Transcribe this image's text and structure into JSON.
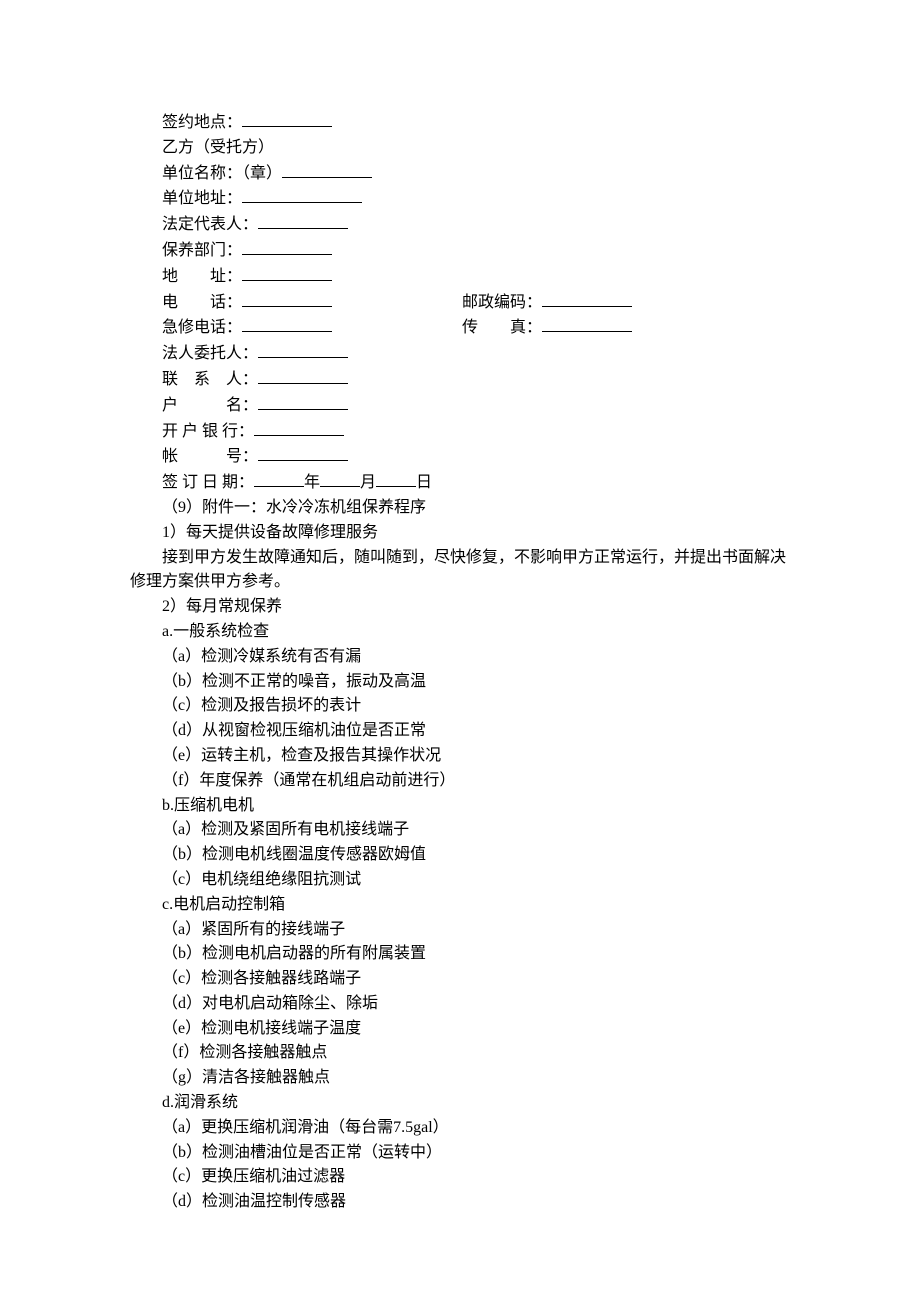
{
  "form": {
    "sign_location_label": "签约地点：",
    "party_b_label": "乙方（受托方）",
    "unit_name_label": "单位名称：（章）",
    "unit_address_label": "单位地址：",
    "legal_rep_label": "法定代表人：",
    "maintenance_dept_label": "保养部门：",
    "address_label": "地  址：",
    "phone_label": "电  话：",
    "postal_code_label": "邮政编码：",
    "urgent_phone_label": "急修电话：",
    "fax_label": "传  真：",
    "legal_entrustee_label": "法人委托人：",
    "contact_label": "联 系 人：",
    "account_name_label": "户   名：",
    "bank_label": "开 户 银 行：",
    "account_number_label": "帐   号：",
    "sign_date_label": "签 订 日 期：",
    "year": "年",
    "month": "月",
    "day": "日"
  },
  "appendix": {
    "title": "（9）附件一：水冷冷冻机组保养程序",
    "item1": "1）每天提供设备故障修理服务",
    "item1_desc": "接到甲方发生故障通知后，随叫随到，尽快修复，不影响甲方正常运行，并提出书面解决修理方案供甲方参考。",
    "item2": "2）每月常规保养",
    "a_title": "a.一般系统检查",
    "a_items": [
      "（a）检测冷媒系统有否有漏",
      "（b）检测不正常的噪音，振动及高温",
      "（c）检测及报告损坏的表计",
      "（d）从视窗检视压缩机油位是否正常",
      "（e）运转主机，检查及报告其操作状况",
      "（f）年度保养（通常在机组启动前进行）"
    ],
    "b_title": "b.压缩机电机",
    "b_items": [
      "（a）检测及紧固所有电机接线端子",
      "（b）检测电机线圈温度传感器欧姆值",
      "（c）电机绕组绝缘阻抗测试"
    ],
    "c_title": "c.电机启动控制箱",
    "c_items": [
      "（a）紧固所有的接线端子",
      "（b）检测电机启动器的所有附属装置",
      "（c）检测各接触器线路端子",
      "（d）对电机启动箱除尘、除垢",
      "（e）检测电机接线端子温度",
      "（f）检测各接触器触点",
      "（g）清洁各接触器触点"
    ],
    "d_title": "d.润滑系统",
    "d_items": [
      "（a）更换压缩机润滑油（每台需7.5gal）",
      "（b）检测油槽油位是否正常（运转中）",
      "（c）更换压缩机油过滤器",
      "（d）检测油温控制传感器"
    ]
  }
}
